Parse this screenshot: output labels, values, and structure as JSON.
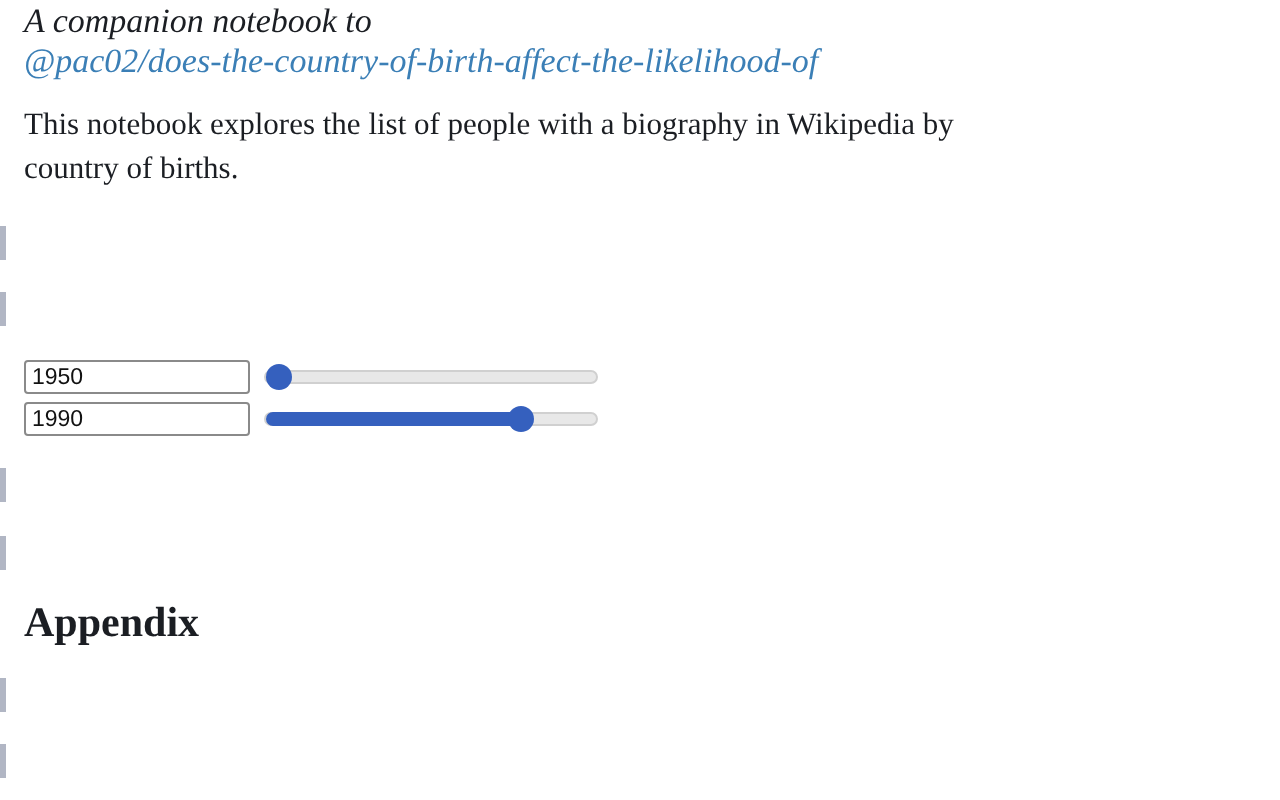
{
  "intro": {
    "text": "A companion notebook to ",
    "link": "@pac02/does-the-country-of-birth-affect-the-likelihood-of"
  },
  "description": "This notebook explores the list of people with a biography in Wikipedia by country of births.",
  "sliders": [
    {
      "value": "1950",
      "level": 0
    },
    {
      "value": "1990",
      "level": 0.8
    }
  ],
  "appendix_heading": "Appendix"
}
